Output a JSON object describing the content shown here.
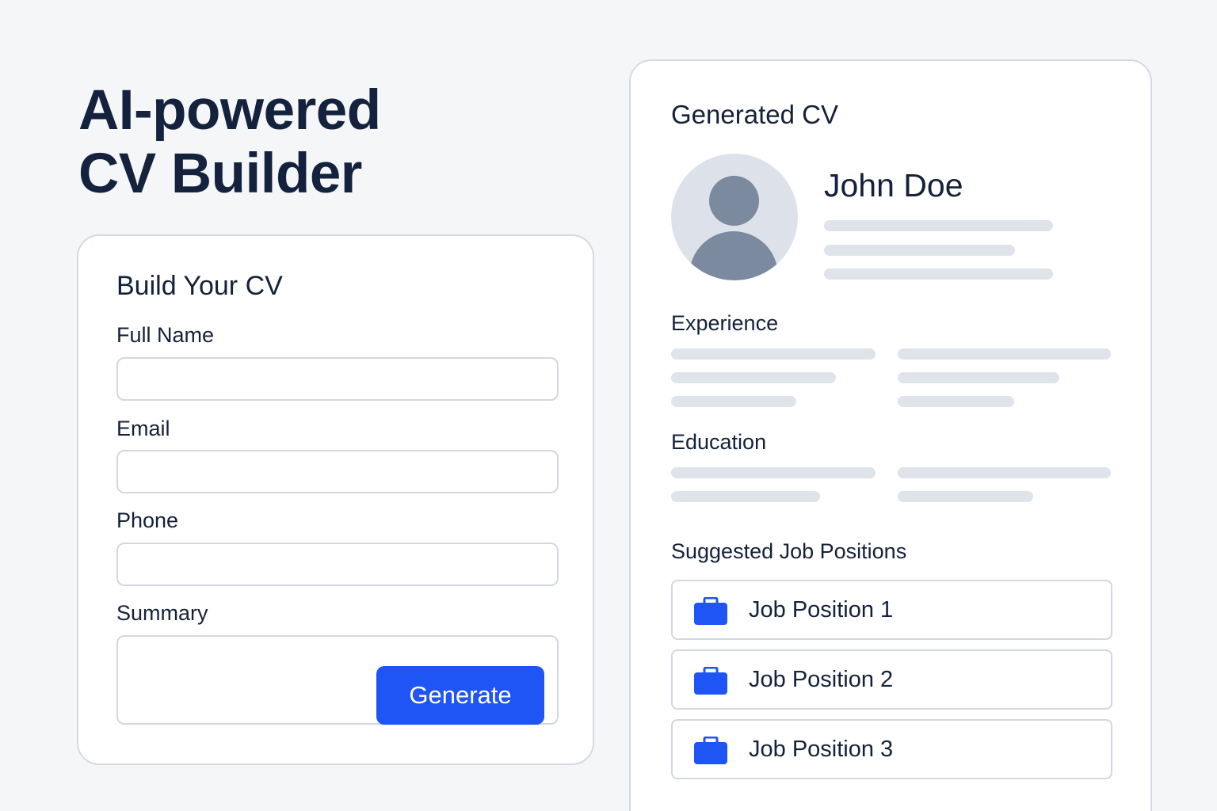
{
  "hero": {
    "line1": "AI-powered",
    "line2": "CV Builder"
  },
  "form": {
    "title": "Build Your CV",
    "fields": {
      "full_name": {
        "label": "Full Name",
        "value": ""
      },
      "email": {
        "label": "Email",
        "value": ""
      },
      "phone": {
        "label": "Phone",
        "value": ""
      },
      "summary": {
        "label": "Summary",
        "value": ""
      }
    },
    "generate_label": "Generate"
  },
  "cv": {
    "title": "Generated CV",
    "name": "John Doe",
    "sections": {
      "experience": "Experience",
      "education": "Education",
      "suggested_jobs": "Suggested Job Positions"
    },
    "jobs": [
      {
        "label": "Job Position 1",
        "icon": "briefcase-icon"
      },
      {
        "label": "Job Position 2",
        "icon": "briefcase-icon"
      },
      {
        "label": "Job Position 3",
        "icon": "briefcase-icon"
      }
    ]
  },
  "colors": {
    "accent": "#1f55f5",
    "text": "#15213a",
    "placeholder": "#dfe4eb",
    "avatar": "#7b8a9e"
  }
}
